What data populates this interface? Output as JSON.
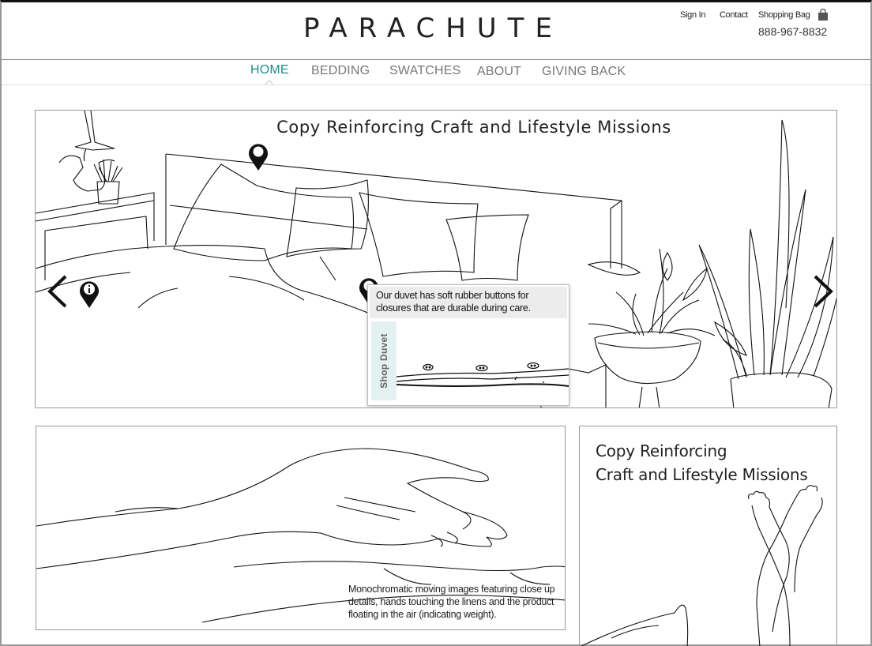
{
  "brand": {
    "logo": "PARACHUTE"
  },
  "header": {
    "sign_in": "Sign In",
    "contact": "Contact",
    "shopping_bag": "Shopping Bag",
    "phone": "888-967-8832"
  },
  "nav": {
    "items": [
      {
        "label": "HOME",
        "active": true
      },
      {
        "label": "BEDDING"
      },
      {
        "label": "SWATCHES"
      },
      {
        "label": "ABOUT"
      },
      {
        "label": "GIVING BACK"
      }
    ],
    "active_color": "#1e8c8c"
  },
  "hero": {
    "title": "Copy Reinforcing Craft and Lifestyle Missions",
    "popover": {
      "text": "Our duvet has soft rubber buttons for closures that are durable during care.",
      "shop_label": "Shop Duvet"
    }
  },
  "panels": {
    "left_caption": "Monochromatic moving images featuring close up details, hands touching the linens and the product floating in the air (indicating weight).",
    "right_title_line1": "Copy Reinforcing",
    "right_title_line2": "Craft and Lifestyle Missions"
  },
  "icons": {
    "bag": "shopping-bag-icon",
    "prev": "chevron-left-icon",
    "next": "chevron-right-icon",
    "pin": "map-pin-icon",
    "info_pin": "info-pin-icon"
  }
}
